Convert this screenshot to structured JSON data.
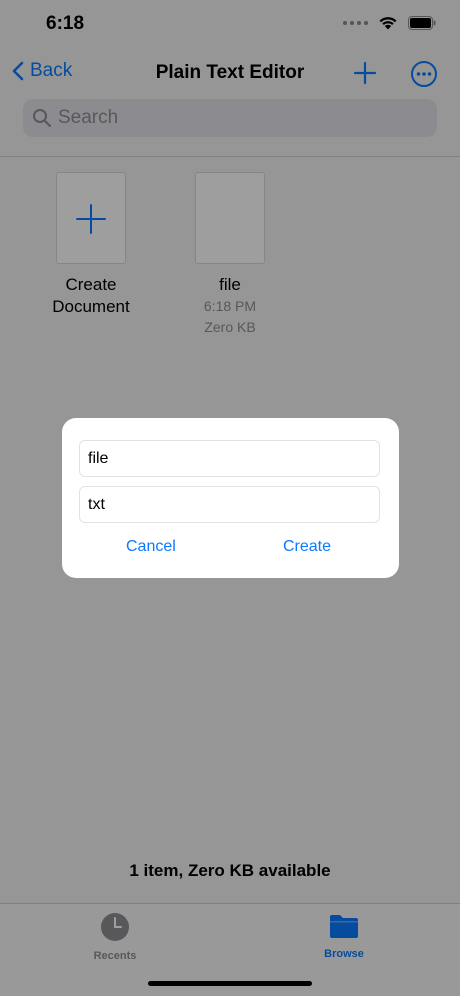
{
  "status_bar": {
    "time": "6:18"
  },
  "nav": {
    "back_label": "Back",
    "title": "Plain Text Editor"
  },
  "search": {
    "placeholder": "Search"
  },
  "documents": [
    {
      "name_line1": "Create",
      "name_line2": "Document"
    },
    {
      "name": "file",
      "time": "6:18 PM",
      "size": "Zero KB"
    }
  ],
  "storage_info": "1 item, Zero KB available",
  "tabs": [
    {
      "label": "Recents",
      "active": false
    },
    {
      "label": "Browse",
      "active": true
    }
  ],
  "dialog": {
    "name_value": "file",
    "extension_value": "txt",
    "cancel_label": "Cancel",
    "create_label": "Create"
  },
  "colors": {
    "accent": "#0a7aff",
    "inactive": "#8e8e93"
  }
}
